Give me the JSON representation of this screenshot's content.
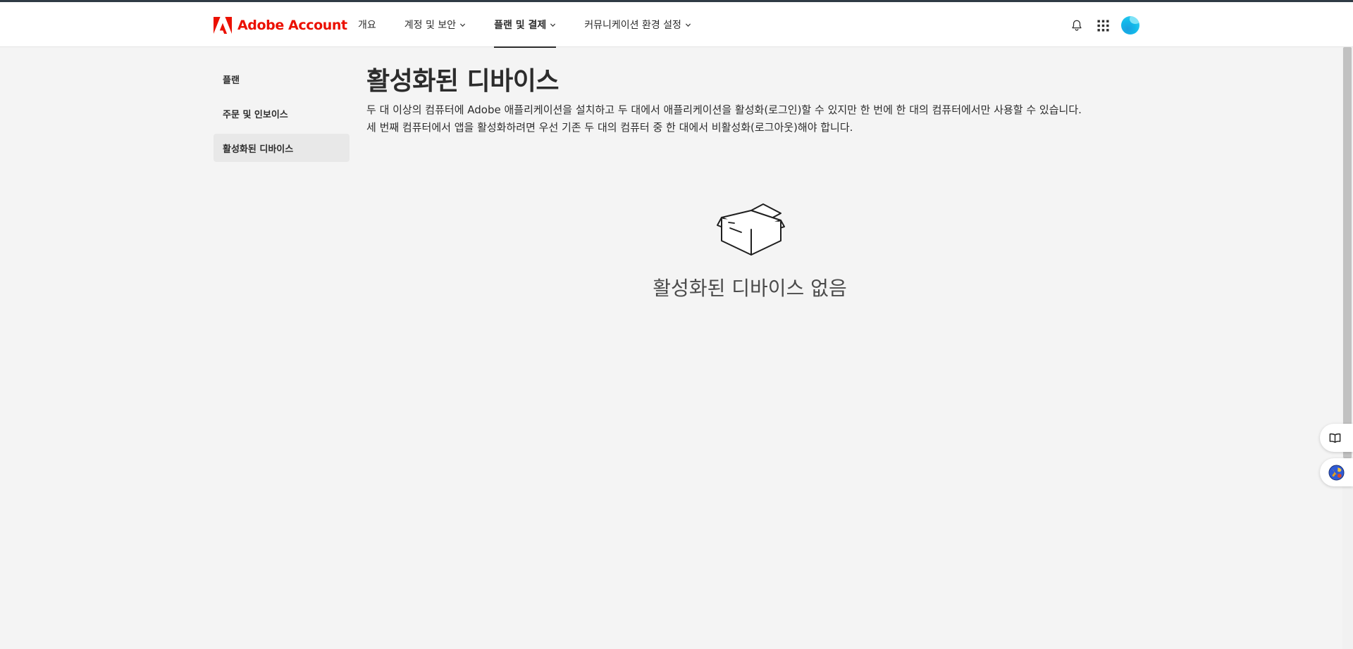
{
  "header": {
    "logo_text": "Adobe Account",
    "nav": [
      {
        "label": "개요"
      },
      {
        "label": "계정 및 보안"
      },
      {
        "label": "플랜 및 결제"
      },
      {
        "label": "커뮤니케이션 환경 설정"
      }
    ],
    "icons": [
      "bell-icon",
      "apps-grid-icon",
      "user-avatar"
    ]
  },
  "sidebar": {
    "items": [
      {
        "label": "플랜"
      },
      {
        "label": "주문 및 인보이스"
      },
      {
        "label": "활성화된 디바이스"
      }
    ]
  },
  "main": {
    "title": "활성화된 디바이스",
    "description_line1": "두 대 이상의 컴퓨터에 Adobe 애플리케이션을 설치하고 두 대에서 애플리케이션을 활성화(로그인)할 수 있지만 한 번에 한 대의 컴퓨터에서만 사용할 수 있습니다.",
    "description_line2": "세 번째 컴퓨터에서 앱을 활성화하려면 우선 기존 두 대의 컴퓨터 중 한 대에서 비활성화(로그아웃)해야 합니다.",
    "empty_state": {
      "icon": "open-box-icon",
      "title": "활성화된 디바이스 없음"
    }
  },
  "floating_buttons": [
    "book-icon",
    "extension-globe-icon"
  ],
  "colors": {
    "brand_red": "#eb1000",
    "page_background": "#f4f4f4",
    "header_background": "#ffffff",
    "selected_item_background": "#e8e8e8",
    "text": "#2c2c2c"
  }
}
